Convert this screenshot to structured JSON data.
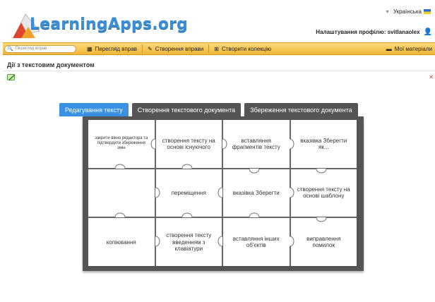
{
  "header": {
    "logo_text": "LearningApps.org",
    "language": "Українська",
    "profile_text": "Налаштування профілю: svitlanaolex"
  },
  "toolbar": {
    "search_placeholder": "Перегляд вправ",
    "items": [
      {
        "label": "Перегляд вправ",
        "icon": "grid-icon"
      },
      {
        "label": "Створення вправи",
        "icon": "pencil-icon"
      },
      {
        "label": "Створити колекцію",
        "icon": "collection-icon"
      }
    ],
    "my_materials": "Мої матеріали"
  },
  "page": {
    "title": "Дії з текстовим документом"
  },
  "tabs": [
    {
      "label": "Редагування тексту",
      "active": true
    },
    {
      "label": "Створення текстового документа",
      "active": false
    },
    {
      "label": "Збереження текстового документа",
      "active": false
    }
  ],
  "puzzle": {
    "cells": [
      "закрити вікно редактора та підтвердити збереження змін",
      "створення тексту на основі існуючого",
      "вставляння фрагментів тексту",
      "вказівка Зберегти як...",
      "",
      "переміщення",
      "вказівка Зберегти",
      "створення тексту на основі шаблону",
      "копіювання",
      "створення тексту введенням з клавіатури",
      "вставляння інших об'єктів",
      "виправлення помилок"
    ]
  },
  "colors": {
    "brand_blue": "#3b8fd6",
    "toolbar_yellow": "#f0b736",
    "tab_active": "#3a91e3",
    "tab_inactive": "#555555",
    "board": "#555555"
  }
}
